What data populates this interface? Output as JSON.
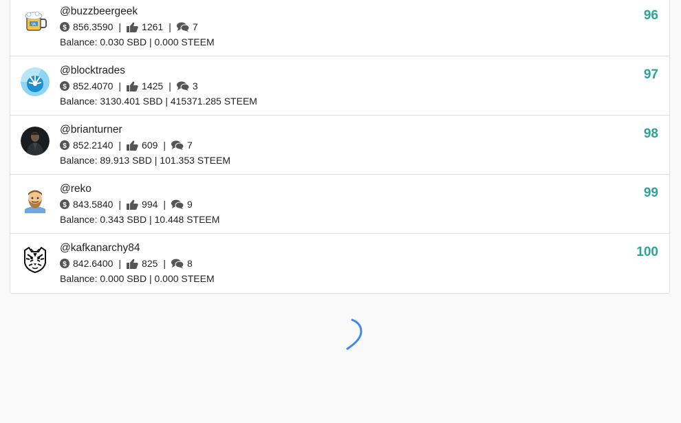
{
  "accent_color": "#26a69a",
  "spinner_color": "#4285f4",
  "users": [
    {
      "username": "@buzzbeergeek",
      "reputation": "856.3590",
      "likes": "1261",
      "comments": "7",
      "balance": "Balance: 0.030 SBD | 0.000 STEEM",
      "rank": "96",
      "avatar_icon": "beer-mug-icon"
    },
    {
      "username": "@blocktrades",
      "reputation": "852.4070",
      "likes": "1425",
      "comments": "3",
      "balance": "Balance: 3130.401 SBD | 415371.285 STEEM",
      "rank": "97",
      "avatar_icon": "blocktrades-logo-icon"
    },
    {
      "username": "@brianturner",
      "reputation": "852.2140",
      "likes": "609",
      "comments": "7",
      "balance": "Balance: 89.913 SBD | 101.353 STEEM",
      "rank": "98",
      "avatar_icon": "person-photo-icon"
    },
    {
      "username": "@reko",
      "reputation": "843.5840",
      "likes": "994",
      "comments": "9",
      "balance": "Balance: 0.343 SBD | 10.448 STEEM",
      "rank": "99",
      "avatar_icon": "bearded-face-icon"
    },
    {
      "username": "@kafkanarchy84",
      "reputation": "842.6400",
      "likes": "825",
      "comments": "8",
      "balance": "Balance: 0.000 SBD | 0.000 STEEM",
      "rank": "100",
      "avatar_icon": "tiger-sketch-icon"
    }
  ],
  "separator": "|"
}
